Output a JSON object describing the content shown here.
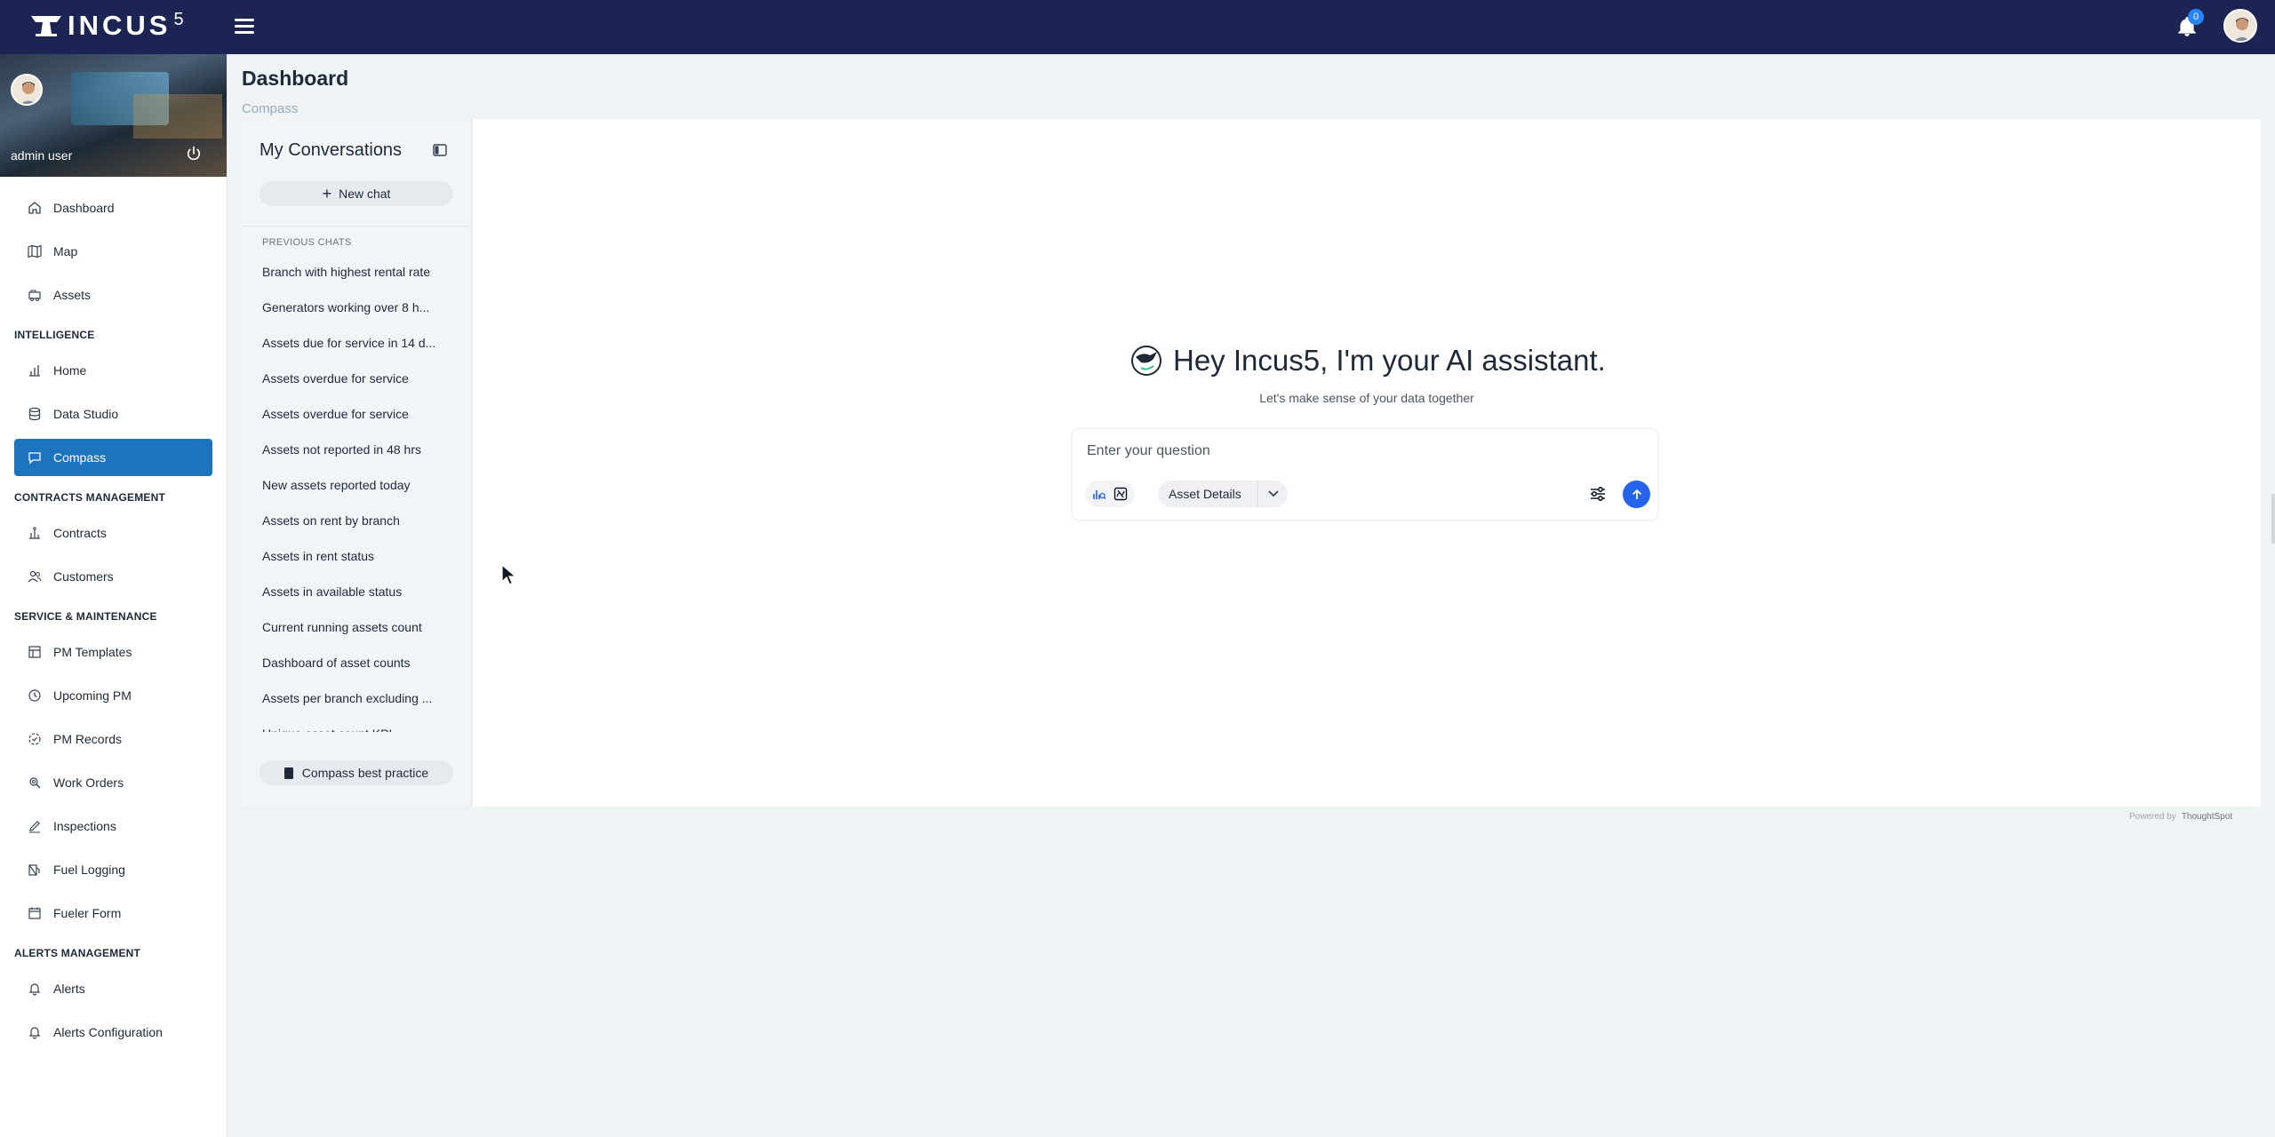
{
  "app": {
    "logo_text": "INCUS",
    "logo_sup": "5",
    "notification_count": "0"
  },
  "sidebar": {
    "username": "admin user",
    "items_top": [
      {
        "label": "Dashboard",
        "icon": "home-icon"
      },
      {
        "label": "Map",
        "icon": "map-icon"
      },
      {
        "label": "Assets",
        "icon": "assets-icon"
      }
    ],
    "sections": [
      {
        "title": "INTELLIGENCE",
        "items": [
          {
            "label": "Home",
            "icon": "chart-icon"
          },
          {
            "label": "Data Studio",
            "icon": "database-icon"
          },
          {
            "label": "Compass",
            "icon": "chat-icon",
            "active": true
          }
        ]
      },
      {
        "title": "CONTRACTS MANAGEMENT",
        "items": [
          {
            "label": "Contracts",
            "icon": "contract-icon"
          },
          {
            "label": "Customers",
            "icon": "users-icon"
          }
        ]
      },
      {
        "title": "SERVICE & MAINTENANCE",
        "items": [
          {
            "label": "PM Templates",
            "icon": "template-icon"
          },
          {
            "label": "Upcoming PM",
            "icon": "clock-icon"
          },
          {
            "label": "PM Records",
            "icon": "records-icon"
          },
          {
            "label": "Work Orders",
            "icon": "work-orders-icon"
          },
          {
            "label": "Inspections",
            "icon": "pencil-icon"
          },
          {
            "label": "Fuel Logging",
            "icon": "fuel-icon"
          },
          {
            "label": "Fueler Form",
            "icon": "calendar-icon"
          }
        ]
      },
      {
        "title": "ALERTS MANAGEMENT",
        "items": [
          {
            "label": "Alerts",
            "icon": "bell-icon"
          },
          {
            "label": "Alerts Configuration",
            "icon": "bell-settings-icon"
          }
        ]
      }
    ]
  },
  "header": {
    "title": "Dashboard",
    "breadcrumb": "Compass"
  },
  "conversations": {
    "title": "My Conversations",
    "new_chat_label": "New chat",
    "previous_label": "PREVIOUS CHATS",
    "chats": [
      "Branch with highest rental rate",
      "Generators working over 8 h...",
      "Assets due for service in 14 d...",
      "Assets overdue for service",
      "Assets overdue for service",
      "Assets not reported in 48 hrs",
      "New assets reported today",
      "Assets on rent by branch",
      "Assets in rent status",
      "Assets in available status",
      "Current running assets count",
      "Dashboard of asset counts",
      "Assets per branch excluding ...",
      "Unique asset count KPI"
    ],
    "best_practice_label": "Compass best practice"
  },
  "assistant": {
    "greeting": "Hey Incus5, I'm your AI assistant.",
    "subtitle": "Let's make sense of your data together",
    "question_placeholder": "Enter your question",
    "source_label": "Asset Details",
    "powered_by": "Powered by",
    "powered_brand": "ThoughtSpot"
  },
  "colors": {
    "topbar": "#1b2452",
    "active_nav": "#1e73be",
    "send_button": "#2563eb",
    "badge": "#2684ff"
  }
}
